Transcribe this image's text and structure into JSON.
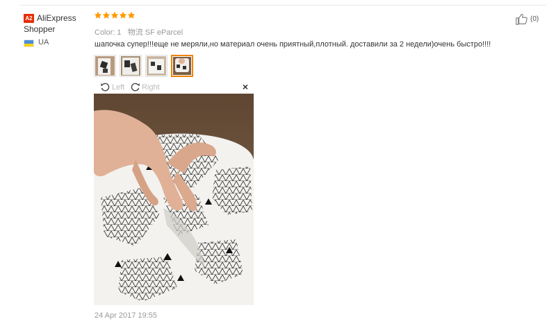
{
  "user": {
    "badge": "A2",
    "name_line1": "AliExpress",
    "name_line2": "Shopper",
    "country": "UA"
  },
  "review": {
    "rating": 5,
    "color_label": "Color:",
    "color_value": "1",
    "shipping_label": "物流",
    "shipping_value": "SF eParcel",
    "text": "шапочка супер!!!еще не меряли,но материал очень приятный,плотный. доставили за 2 недели)очень быстро!!!!",
    "helpful_count": "(0)",
    "date": "24 Apr 2017 19:55"
  },
  "viewer": {
    "rotate_left_label": "Left",
    "rotate_right_label": "Right",
    "close_label": "×"
  },
  "thumbnails": [
    {
      "name": "review-photo-thumbnail-1",
      "active": false
    },
    {
      "name": "review-photo-thumbnail-2",
      "active": false
    },
    {
      "name": "review-photo-thumbnail-3",
      "active": false
    },
    {
      "name": "review-photo-thumbnail-4",
      "active": true
    }
  ],
  "colors": {
    "badge": "#e62e04",
    "star": "#ff9a00",
    "active_thumb_border": "#f08200",
    "muted_text": "#999999"
  },
  "icons": {
    "star": "star-icon",
    "thumbs_up": "thumbs-up-icon",
    "rotate_left": "rotate-left-icon",
    "rotate_right": "rotate-right-icon",
    "close": "close-icon"
  }
}
